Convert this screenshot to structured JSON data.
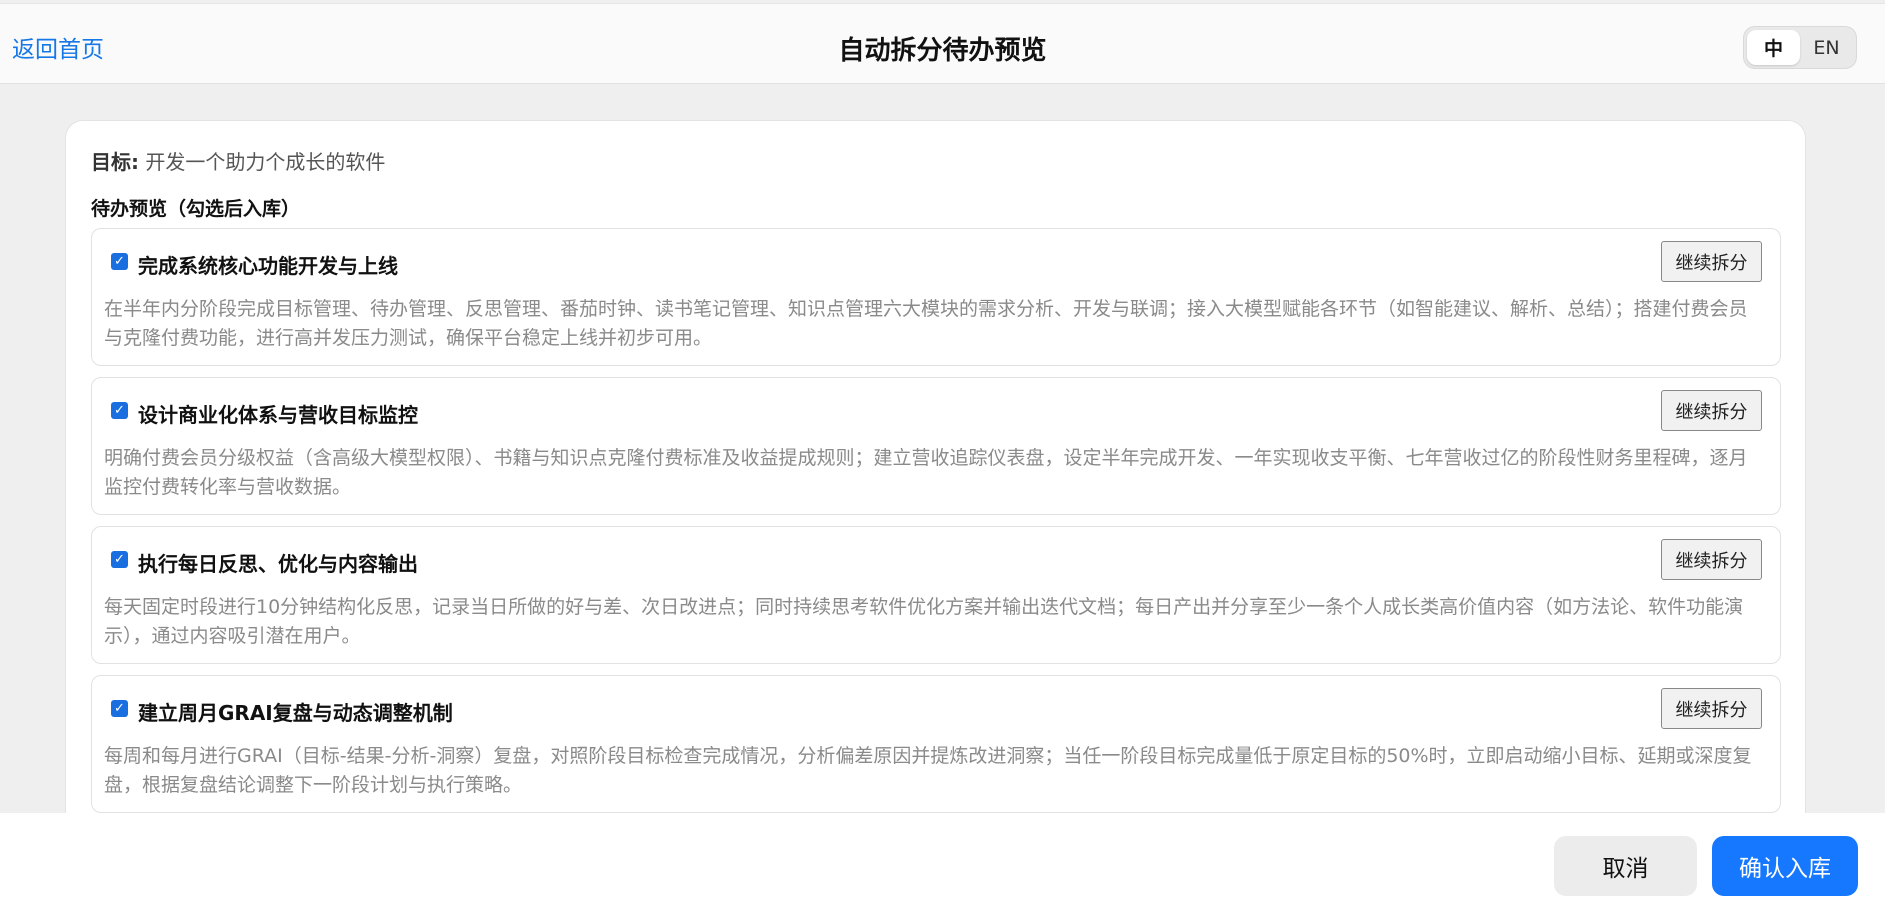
{
  "header": {
    "back_label": "返回首页",
    "title": "自动拆分待办预览",
    "lang_options": [
      "中",
      "EN"
    ],
    "lang_active": "中"
  },
  "goal": {
    "label": "目标:",
    "text": "开发一个助力个成长的软件"
  },
  "section_title": "待办预览（勾选后入库）",
  "tasks": [
    {
      "checked": true,
      "title": "完成系统核心功能开发与上线",
      "button": "继续拆分",
      "desc": "在半年内分阶段完成目标管理、待办管理、反思管理、番茄时钟、读书笔记管理、知识点管理六大模块的需求分析、开发与联调；接入大模型赋能各环节（如智能建议、解析、总结）；搭建付费会员与克隆付费功能，进行高并发压力测试，确保平台稳定上线并初步可用。"
    },
    {
      "checked": true,
      "title": "设计商业化体系与营收目标监控",
      "button": "继续拆分",
      "desc": "明确付费会员分级权益（含高级大模型权限）、书籍与知识点克隆付费标准及收益提成规则；建立营收追踪仪表盘，设定半年完成开发、一年实现收支平衡、七年营收过亿的阶段性财务里程碑，逐月监控付费转化率与营收数据。"
    },
    {
      "checked": true,
      "title": "执行每日反思、优化与内容输出",
      "button": "继续拆分",
      "desc": "每天固定时段进行10分钟结构化反思，记录当日所做的好与差、次日改进点；同时持续思考软件优化方案并输出迭代文档；每日产出并分享至少一条个人成长类高价值内容（如方法论、软件功能演示），通过内容吸引潜在用户。"
    },
    {
      "checked": true,
      "title": "建立周月GRAI复盘与动态调整机制",
      "button": "继续拆分",
      "desc": "每周和每月进行GRAI（目标-结果-分析-洞察）复盘，对照阶段目标检查完成情况，分析偏差原因并提炼改进洞察；当任一阶段目标完成量低于原定目标的50%时，立即启动缩小目标、延期或深度复盘，根据复盘结论调整下一阶段计划与执行策略。"
    }
  ],
  "footer": {
    "cancel_label": "取消",
    "confirm_label": "确认入库"
  },
  "colors": {
    "accent": "#1677ff",
    "link": "#1677e6",
    "checkbox": "#1a6fe0"
  }
}
